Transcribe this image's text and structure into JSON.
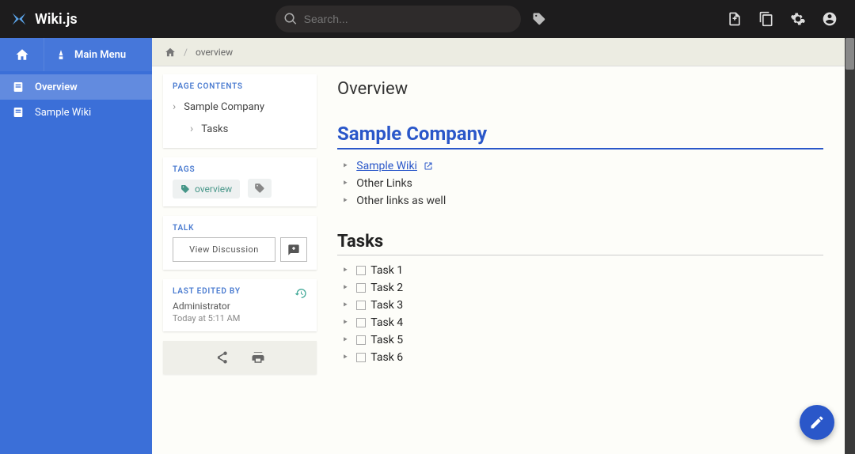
{
  "brand": {
    "name": "Wiki.js"
  },
  "search": {
    "placeholder": "Search..."
  },
  "sidebar": {
    "main_menu_label": "Main Menu",
    "items": [
      {
        "label": "Overview",
        "active": true
      },
      {
        "label": "Sample Wiki",
        "active": false
      }
    ]
  },
  "breadcrumb": {
    "current": "overview"
  },
  "panels": {
    "toc_label": "PAGE CONTENTS",
    "toc": [
      {
        "label": "Sample Company",
        "sub": false
      },
      {
        "label": "Tasks",
        "sub": true
      }
    ],
    "tags_label": "TAGS",
    "tags": [
      "overview"
    ],
    "talk_label": "TALK",
    "view_discussion": "View Discussion",
    "edited_label": "LAST EDITED BY",
    "edited_by": "Administrator",
    "edited_time": "Today at 5:11 AM"
  },
  "page": {
    "title": "Overview",
    "h2_company": "Sample Company",
    "links": [
      {
        "text": "Sample Wiki",
        "is_link": true
      },
      {
        "text": "Other Links",
        "is_link": false
      },
      {
        "text": "Other links as well",
        "is_link": false
      }
    ],
    "h2_tasks": "Tasks",
    "tasks": [
      "Task 1",
      "Task 2",
      "Task 3",
      "Task 4",
      "Task 5",
      "Task 6"
    ]
  }
}
